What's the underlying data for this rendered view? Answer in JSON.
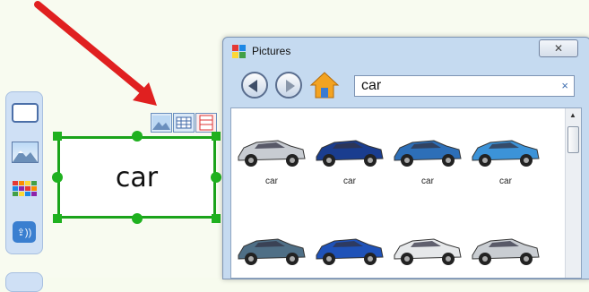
{
  "window": {
    "title": "Pictures",
    "close_glyph": "✕"
  },
  "search": {
    "value": "car",
    "clear_glyph": "×"
  },
  "frame": {
    "text": "car"
  },
  "results": [
    {
      "label": "car",
      "color": "#c8ccd2",
      "icon": "silver-sedan-icon"
    },
    {
      "label": "car",
      "color": "#1a3d8f",
      "icon": "blue-estate-car-icon"
    },
    {
      "label": "car",
      "color": "#2d6fb8",
      "icon": "blue-hatchback-icon"
    },
    {
      "label": "car",
      "color": "#3c93d8",
      "icon": "light-blue-minivan-icon"
    },
    {
      "label": "",
      "color": "#4f6f86",
      "icon": "suv-icon"
    },
    {
      "label": "",
      "color": "#1f52b8",
      "icon": "blue-convertible-icon"
    },
    {
      "label": "",
      "color": "#e6e8ea",
      "icon": "white-hatchback-open-icon"
    },
    {
      "label": "",
      "color": "#c9cdd2",
      "icon": "silver-hatchback-icon"
    }
  ],
  "colors": {
    "frame_border": "#1aa31a",
    "arrow": "#e02020",
    "toolbar_bg": "#cfe0f5"
  }
}
